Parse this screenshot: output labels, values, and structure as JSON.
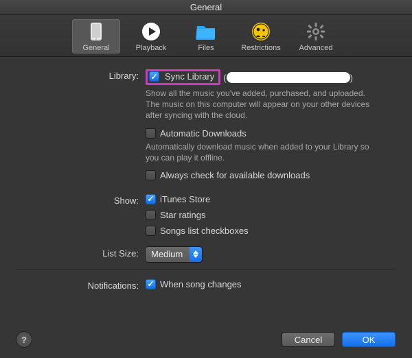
{
  "window": {
    "title": "General"
  },
  "toolbar": {
    "items": [
      {
        "label": "General"
      },
      {
        "label": "Playback"
      },
      {
        "label": "Files"
      },
      {
        "label": "Restrictions"
      },
      {
        "label": "Advanced"
      }
    ]
  },
  "labels": {
    "library": "Library:",
    "show": "Show:",
    "list_size": "List Size:",
    "notifications": "Notifications:"
  },
  "library": {
    "sync_library": "Sync Library",
    "sync_desc": "Show all the music you've added, purchased, and uploaded. The music on this computer will appear on your other devices after syncing with the cloud.",
    "auto_downloads": "Automatic Downloads",
    "auto_desc": "Automatically download music when added to your Library so you can play it offline.",
    "always_check": "Always check for available downloads"
  },
  "show": {
    "itunes_store": "iTunes Store",
    "star_ratings": "Star ratings",
    "songs_checkboxes": "Songs list checkboxes"
  },
  "list_size": {
    "value": "Medium"
  },
  "notifications": {
    "when_song_changes": "When song changes"
  },
  "footer": {
    "help": "?",
    "cancel": "Cancel",
    "ok": "OK"
  }
}
